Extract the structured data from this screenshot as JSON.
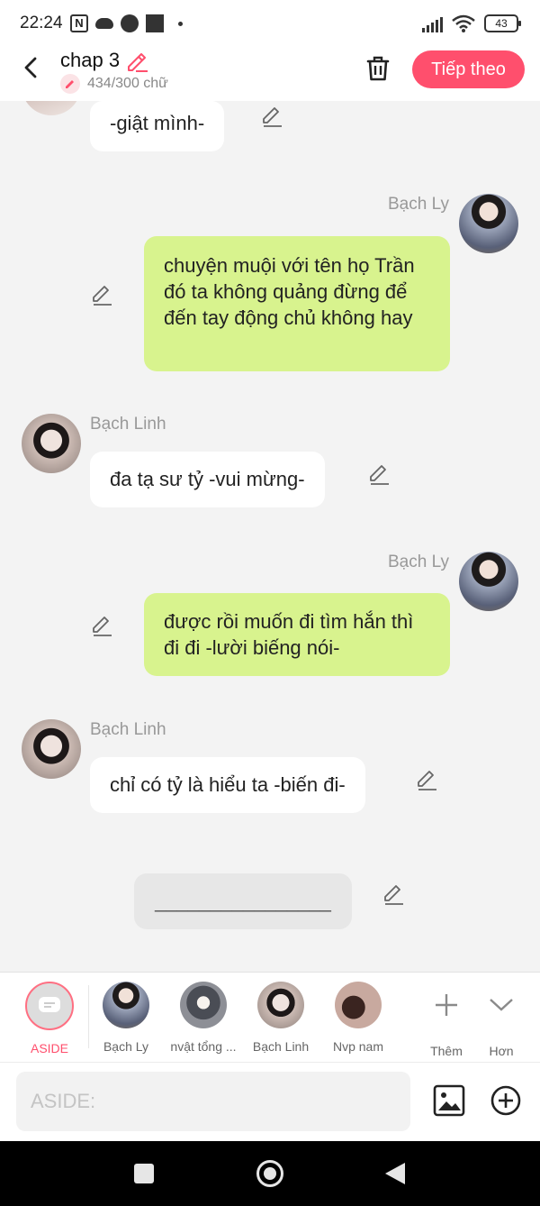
{
  "status_bar": {
    "time": "22:24",
    "battery": "43"
  },
  "header": {
    "title": "chap 3",
    "word_count": "434/300 chữ",
    "next_label": "Tiếp theo"
  },
  "messages": [
    {
      "side": "left",
      "text": "-giật mình-"
    },
    {
      "side": "right",
      "name": "Bạch Ly",
      "text": "chuyện muội với tên họ Trần đó ta không quảng đừng để đến tay động chủ không hay"
    },
    {
      "side": "left",
      "name": "Bạch Linh",
      "text": "đa tạ sư tỷ -vui mừng-"
    },
    {
      "side": "right",
      "name": "Bạch Ly",
      "text": "được rồi muốn đi tìm hắn thì đi đi -lười biếng nói-"
    },
    {
      "side": "left",
      "name": "Bạch Linh",
      "text": "chỉ có tỷ là hiểu ta -biến đi-"
    },
    {
      "side": "center",
      "text": "________________"
    }
  ],
  "characters": [
    {
      "label": "ASIDE"
    },
    {
      "label": "Bạch Ly"
    },
    {
      "label": "nvật tổng ..."
    },
    {
      "label": "Bạch Linh"
    },
    {
      "label": "Nvp nam"
    },
    {
      "label": "Thêm"
    },
    {
      "label": "Hơn"
    }
  ],
  "input": {
    "placeholder": "ASIDE:"
  },
  "colors": {
    "accent": "#ff4f6d",
    "bubble_right": "#d8f38e",
    "bubble_left": "#ffffff",
    "background": "#f3f3f3"
  }
}
